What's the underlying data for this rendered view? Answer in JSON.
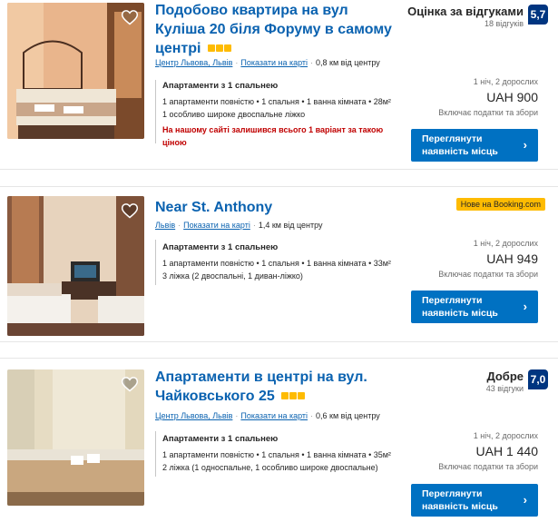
{
  "listings": [
    {
      "title": "Подобово квартира на вул Куліша 20 біля Форуму в самому центрі",
      "location": "Центр Львова, Львів",
      "map_link": "Показати на карті",
      "distance": "0,8 км від центру",
      "room": "Апартаменти з 1 спальнею",
      "details": [
        "1 апартаменти повністю • 1 спальня • 1 ванна кімната • 28м²",
        "1 особливо широке двоспальне ліжко"
      ],
      "warning": "На нашому сайті залишився всього 1 варіант за такою ціною",
      "score_word": "Оцінка за відгуками",
      "score_count": "18 відгуків",
      "score": "5,7",
      "guests": "1 ніч, 2 дорослих",
      "price": "UAH 900",
      "taxes": "Включає податки та збори",
      "button": "Переглянути наявність місць"
    },
    {
      "title": "Near St. Anthony",
      "location": "Львів",
      "map_link": "Показати на карті",
      "distance": "1,4 км від центру",
      "room": "Апартаменти з 1 спальнею",
      "details": [
        "1 апартаменти повністю • 1 спальня • 1 ванна кімната • 33м²",
        "3 ліжка (2 двоспальні, 1 диван-ліжко)"
      ],
      "badge": "Нове на Booking.com",
      "guests": "1 ніч, 2 дорослих",
      "price": "UAH 949",
      "taxes": "Включає податки та збори",
      "button": "Переглянути наявність місць"
    },
    {
      "title": "Апартаменти в центрі на вул. Чайковського 25",
      "location": "Центр Львова, Львів",
      "map_link": "Показати на карті",
      "distance": "0,6 км від центру",
      "room": "Апартаменти з 1 спальнею",
      "details": [
        "1 апартаменти повністю • 1 спальня • 1 ванна кімната • 35м²",
        "2 ліжка (1 односпальне, 1 особливо широке двоспальне)"
      ],
      "score_word": "Добре",
      "score_count": "43 відгуки",
      "score": "7,0",
      "guests": "1 ніч, 2 дорослих",
      "price": "UAH 1 440",
      "taxes": "Включає податки та збори",
      "button": "Переглянути наявність місць"
    }
  ],
  "colors": {
    "link": "#0a62b0",
    "button": "#0071c2",
    "score": "#003580",
    "star": "#febb02",
    "warning": "#c00000"
  },
  "icons": {
    "favorite": "heart-outline-icon",
    "chevron": "chevron-right-icon",
    "rating": "square-star-icon"
  }
}
